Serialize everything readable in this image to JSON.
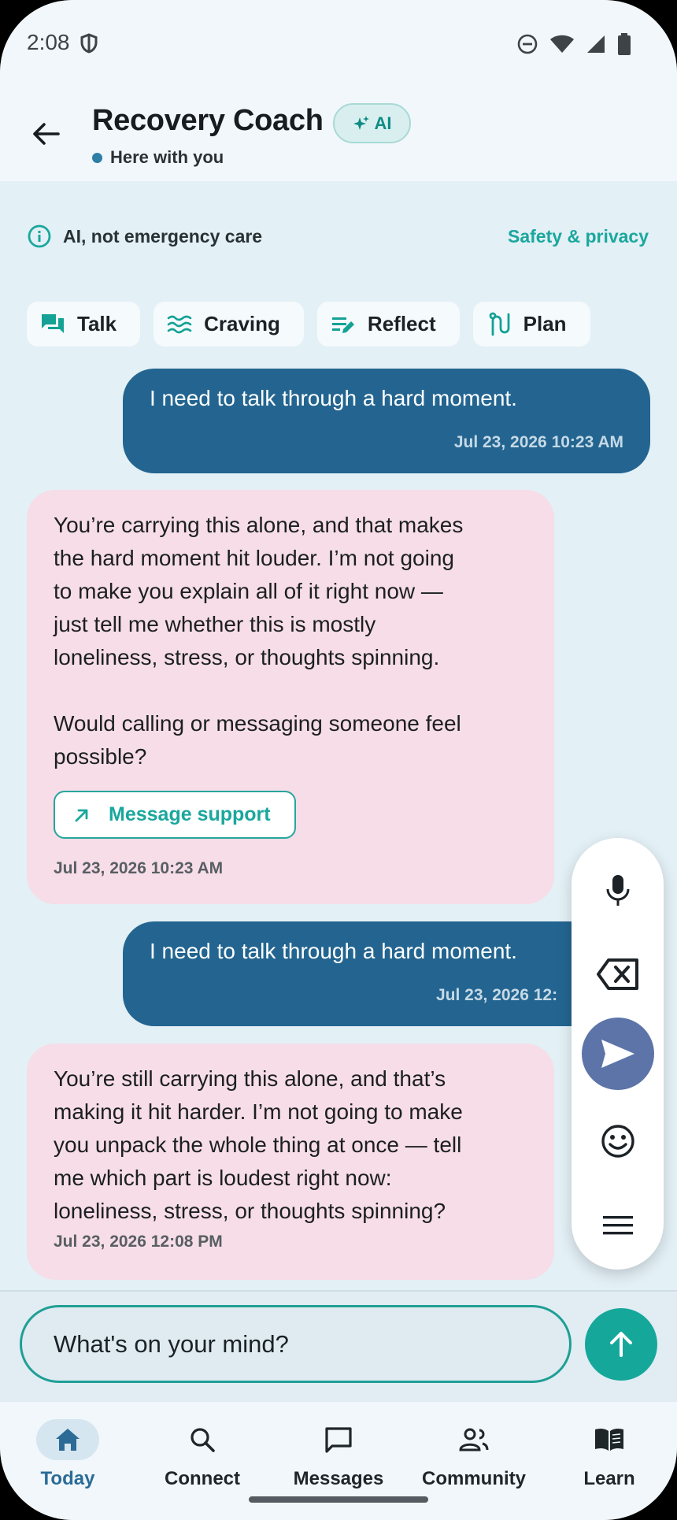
{
  "status_bar": {
    "time": "2:08"
  },
  "header": {
    "title": "Recovery Coach",
    "ai_badge": "AI",
    "presence": "Here with you"
  },
  "notice": {
    "text": "AI, not emergency care",
    "link": "Safety & privacy"
  },
  "quick_actions": [
    {
      "label": "Talk",
      "icon": "chat-bubbles-icon"
    },
    {
      "label": "Craving",
      "icon": "waves-icon"
    },
    {
      "label": "Reflect",
      "icon": "edit-notes-icon"
    },
    {
      "label": "Plan",
      "icon": "route-icon"
    }
  ],
  "messages": [
    {
      "from": "user",
      "text": "I need to talk through a hard moment.",
      "time": "Jul 23, 2026  10:23 AM"
    },
    {
      "from": "coach",
      "text": "You’re carrying this alone, and that makes\nthe hard moment hit louder. I’m not going\nto make you explain all of it right now —\njust tell me whether this is mostly\nloneliness, stress, or thoughts spinning.\n\nWould calling or messaging someone feel\npossible?",
      "action": "Message support",
      "time": "Jul 23, 2026  10:23 AM"
    },
    {
      "from": "user",
      "text": "I need to talk through a hard moment.",
      "time": "Jul 23, 2026  12:"
    },
    {
      "from": "coach",
      "text": "You’re still carrying this alone, and that’s\nmaking it hit harder. I’m not going to make\nyou unpack the whole thing at once — tell\nme which part is loudest right now:\nloneliness, stress, or thoughts spinning?",
      "time": "Jul 23, 2026  12:08 PM"
    }
  ],
  "keyboard_toolbar": [
    "mic-icon",
    "backspace-icon",
    "send-icon",
    "emoji-icon",
    "menu-icon"
  ],
  "composer": {
    "placeholder": "What's on your mind?"
  },
  "nav": [
    {
      "label": "Today",
      "icon": "home-icon",
      "active": true
    },
    {
      "label": "Connect",
      "icon": "search-icon"
    },
    {
      "label": "Messages",
      "icon": "message-icon"
    },
    {
      "label": "Community",
      "icon": "people-icon"
    },
    {
      "label": "Learn",
      "icon": "book-icon"
    }
  ],
  "colors": {
    "accent": "#16a79b",
    "user_bubble": "#236590",
    "coach_bubble": "#f6dde8",
    "background": "#e3f0f6"
  }
}
